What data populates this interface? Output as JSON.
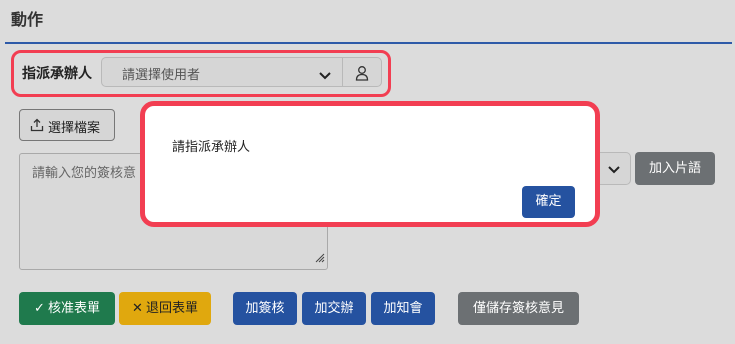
{
  "header": {
    "title": "動作"
  },
  "assign": {
    "label": "指派承辦人",
    "select_placeholder": "請選擇使用者"
  },
  "attachment": {
    "button_label": "選擇檔案"
  },
  "comment": {
    "placeholder": "請輸入您的簽核意"
  },
  "phrase": {
    "add_label": "加入片語"
  },
  "actions": {
    "approve": "核准表單",
    "reject": "退回表單",
    "add_sign": "加簽核",
    "add_handover": "加交辦",
    "add_notify": "加知會",
    "save_only": "僅儲存簽核意見"
  },
  "dialog": {
    "message": "請指派承辦人",
    "confirm_label": "確定"
  },
  "icons": {
    "chevron": "chevron-down-icon",
    "user": "user-icon",
    "upload": "upload-icon",
    "check": "check-icon",
    "close": "close-icon",
    "resize": "resize-grip-icon"
  },
  "colors": {
    "accent_blue": "#2552a0",
    "approve_green": "#1f7a4d",
    "reject_yellow": "#e0a80e",
    "neutral_gray": "#6c7073",
    "highlight_red": "#f23e52"
  }
}
